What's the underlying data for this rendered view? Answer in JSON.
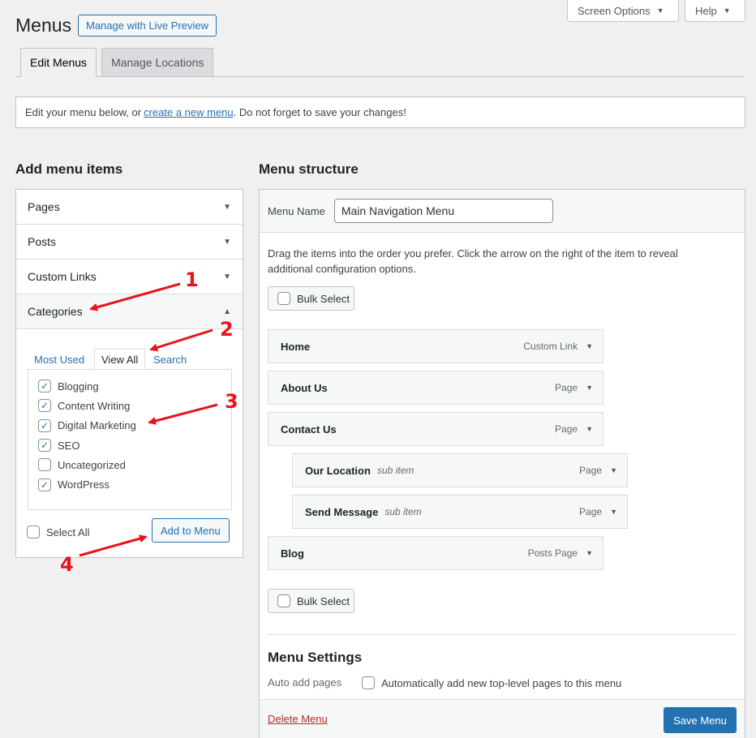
{
  "header": {
    "title": "Menus",
    "live_preview": "Manage with Live Preview",
    "screen_options": "Screen Options",
    "help": "Help"
  },
  "tabs": [
    {
      "label": "Edit Menus",
      "active": true
    },
    {
      "label": "Manage Locations",
      "active": false
    }
  ],
  "notice": {
    "before": "Edit your menu below, or",
    "link": "create a new menu",
    "after": ". Do not forget to save your changes!"
  },
  "add_items": {
    "heading": "Add menu items",
    "sections": [
      "Pages",
      "Posts",
      "Custom Links",
      "Categories"
    ],
    "category_tabs": [
      "Most Used",
      "View All",
      "Search"
    ],
    "categories": [
      {
        "label": "Blogging",
        "checked": true
      },
      {
        "label": "Content Writing",
        "checked": true
      },
      {
        "label": "Digital Marketing",
        "checked": true
      },
      {
        "label": "SEO",
        "checked": true
      },
      {
        "label": "Uncategorized",
        "checked": false
      },
      {
        "label": "WordPress",
        "checked": true
      }
    ],
    "select_all": "Select All",
    "add_button": "Add to Menu"
  },
  "structure": {
    "heading": "Menu structure",
    "menu_name_label": "Menu Name",
    "menu_name_value": "Main Navigation Menu",
    "instructions": "Drag the items into the order you prefer. Click the arrow on the right of the item to reveal additional configuration options.",
    "bulk_select": "Bulk Select",
    "items": [
      {
        "title": "Home",
        "sub": "",
        "type": "Custom Link"
      },
      {
        "title": "About Us",
        "sub": "",
        "type": "Page"
      },
      {
        "title": "Contact Us",
        "sub": "",
        "type": "Page"
      },
      {
        "title": "Our Location",
        "sub": "sub item",
        "type": "Page"
      },
      {
        "title": "Send Message",
        "sub": "sub item",
        "type": "Page"
      },
      {
        "title": "Blog",
        "sub": "",
        "type": "Posts Page"
      }
    ]
  },
  "settings": {
    "heading": "Menu Settings",
    "auto_add_label": "Auto add pages",
    "auto_add_option": "Automatically add new top-level pages to this menu",
    "delete": "Delete Menu",
    "save": "Save Menu"
  },
  "annotations": [
    "1",
    "2",
    "3",
    "4"
  ],
  "colors": {
    "accent": "#2271b1",
    "annotation": "#e8141c",
    "danger": "#b32d2e"
  }
}
